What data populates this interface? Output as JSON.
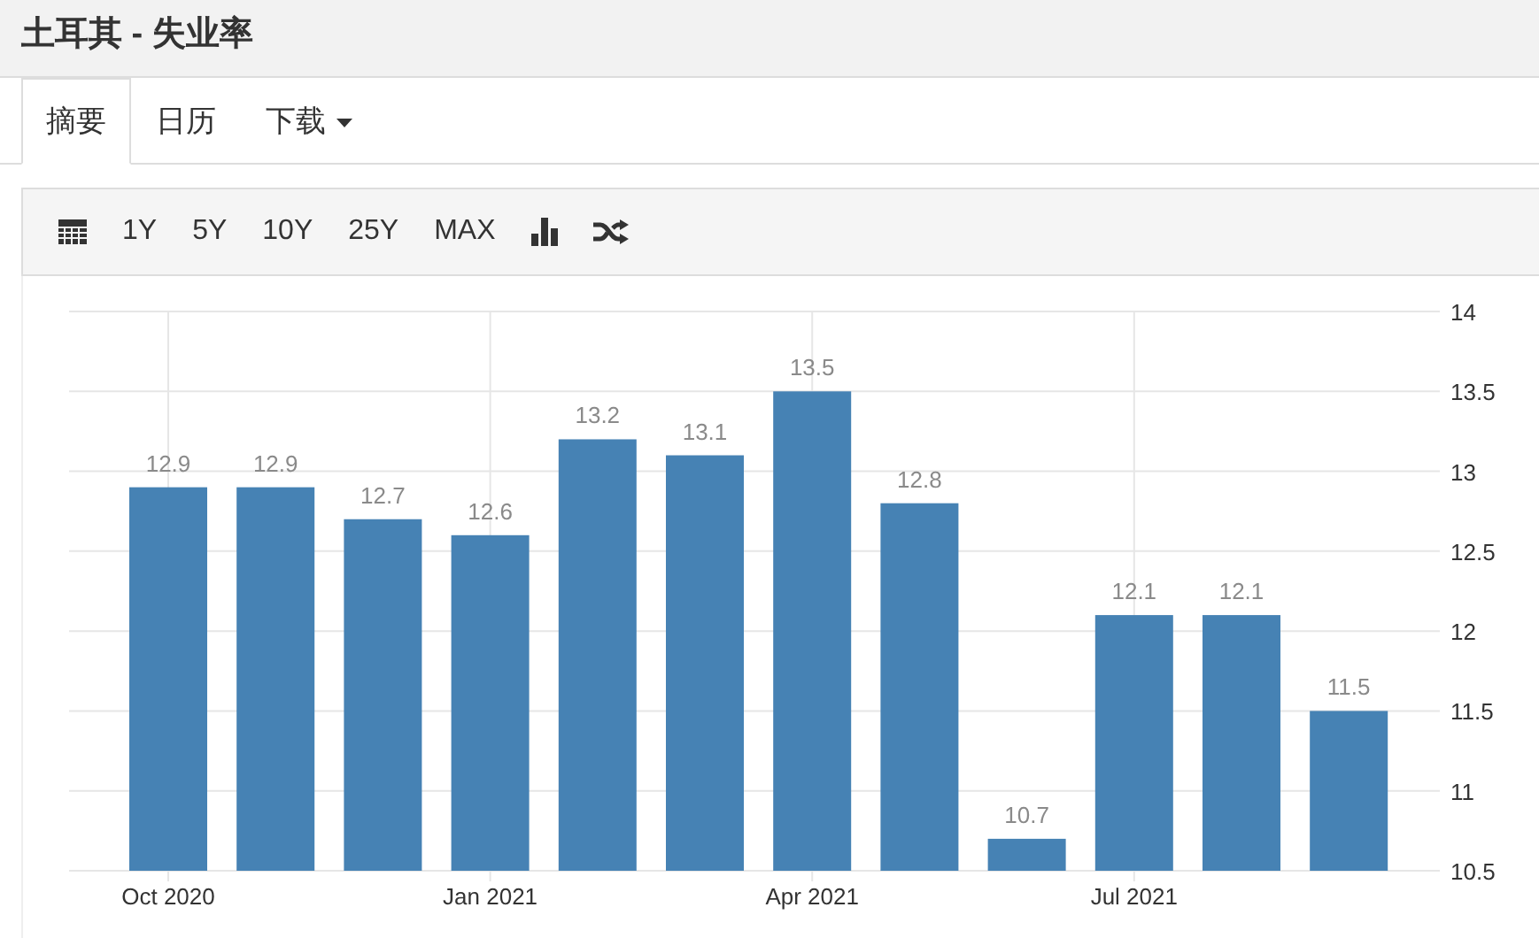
{
  "page_title": "土耳其 - 失业率",
  "tabs": [
    {
      "label": "摘要",
      "selected": true
    },
    {
      "label": "日历",
      "selected": false
    },
    {
      "label": "下载",
      "selected": false,
      "kind": "dropdown"
    }
  ],
  "toolbar": [
    {
      "kind": "calendar"
    },
    {
      "kind": "text",
      "label": "1Y"
    },
    {
      "kind": "text",
      "label": "5Y"
    },
    {
      "kind": "text",
      "label": "10Y"
    },
    {
      "kind": "text",
      "label": "25Y"
    },
    {
      "kind": "text",
      "label": "MAX"
    },
    {
      "kind": "chart"
    },
    {
      "kind": "shuffle"
    }
  ],
  "chart": {
    "chart_data": {
      "type": "bar",
      "data_labels": true,
      "grid": true,
      "categories": [
        "Oct 2020",
        null,
        null,
        "Jan 2021",
        null,
        null,
        "Apr 2021",
        null,
        null,
        "Jul 2021",
        null,
        null
      ],
      "series": [
        {
          "color": "#4682b4",
          "values": [
            12.9,
            12.9,
            12.7,
            12.6,
            13.2,
            13.1,
            13.5,
            12.8,
            10.7,
            12.1,
            12.1,
            11.5
          ]
        }
      ],
      "value_labels": [
        "12.9",
        "12.9",
        "12.7",
        "12.6",
        "13.2",
        "13.1",
        "13.5",
        "12.8",
        "10.7",
        "12.1",
        "12.1",
        "11.5"
      ],
      "ylim": [
        10.5,
        14
      ],
      "yticks": [
        10.5,
        11,
        11.5,
        12,
        12.5,
        13,
        13.5,
        14
      ]
    }
  }
}
